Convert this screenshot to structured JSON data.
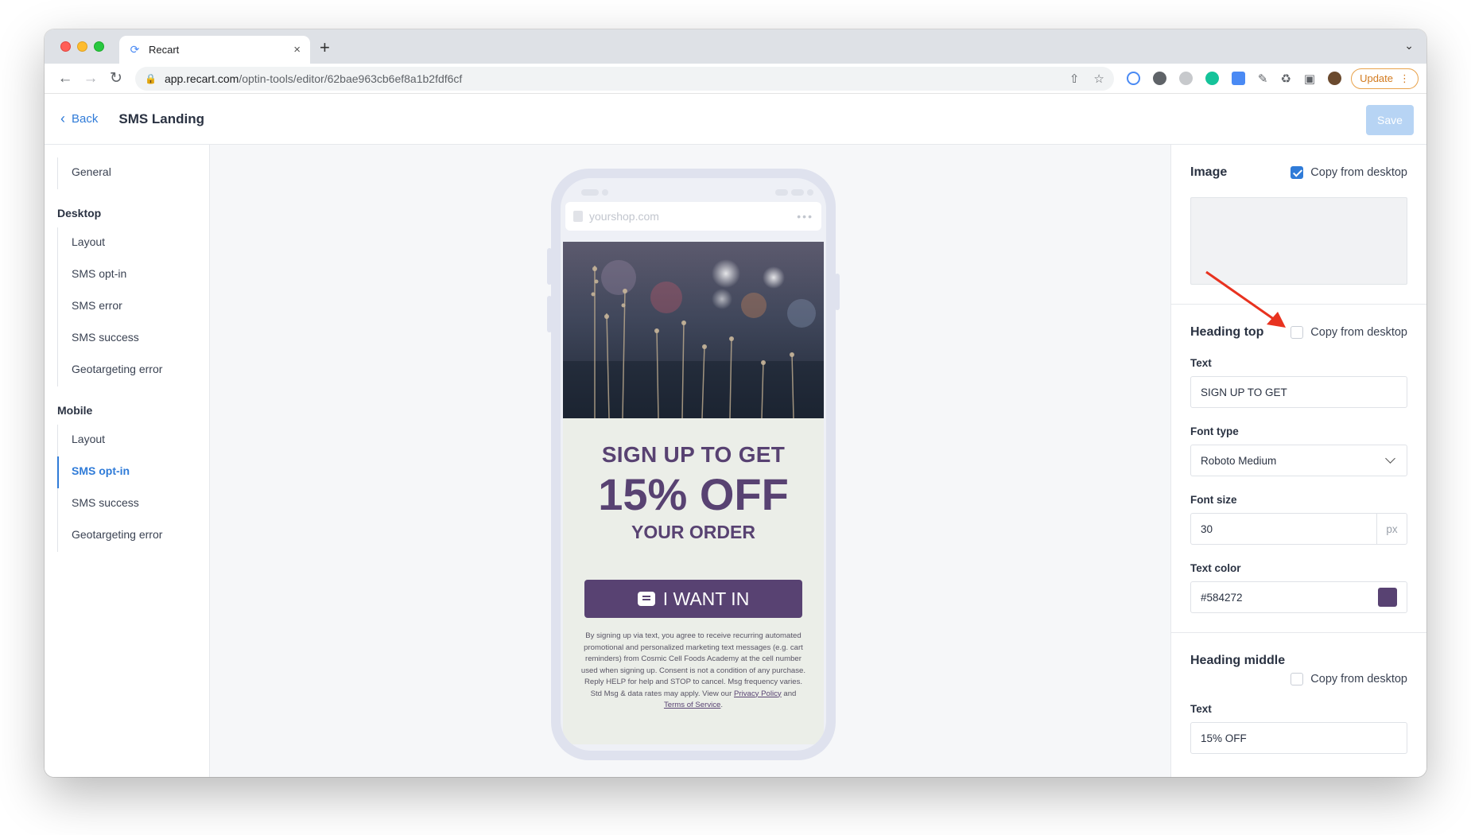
{
  "browser": {
    "tab_title": "Recart",
    "tab_close": "×",
    "new_tab": "+",
    "url_host": "app.recart.com",
    "url_path": "/optin-tools/editor/62bae963cb6ef8a1b2fdf6cf",
    "update_label": "Update",
    "icons": [
      "back-arrow-icon",
      "forward-arrow-icon",
      "reload-icon",
      "lock-icon",
      "share-icon",
      "bookmark-star-icon",
      "extension-icon",
      "puzzle-icon",
      "sidepanel-icon",
      "profile-avatar"
    ]
  },
  "header": {
    "back_label": "Back",
    "page_title": "SMS Landing",
    "save_label": "Save"
  },
  "sidebar": {
    "general": "General",
    "desktop_title": "Desktop",
    "desktop_items": [
      "Layout",
      "SMS opt-in",
      "SMS error",
      "SMS success",
      "Geotargeting error"
    ],
    "mobile_title": "Mobile",
    "mobile_items": [
      "Layout",
      "SMS opt-in",
      "SMS success",
      "Geotargeting error"
    ],
    "active_item": "Mobile / SMS opt-in"
  },
  "preview": {
    "address": "yourshop.com",
    "heading_top": "SIGN UP TO GET",
    "heading_middle": "15% OFF",
    "heading_bottom": "YOUR ORDER",
    "cta_label": "I WANT IN",
    "legal_text": "By signing up via text, you agree to receive recurring automated promotional and personalized marketing text messages (e.g. cart reminders) from Cosmic Cell Foods Academy at the cell number used when signing up. Consent is not a condition of any purchase. Reply HELP for help and STOP to cancel. Msg frequency varies. Std Msg & data rates may apply. View our",
    "privacy_link": "Privacy Policy",
    "and_word": "and",
    "terms_link": "Terms of Service",
    "period": ".",
    "text_color": "#584272",
    "body_background": "#ebeee8"
  },
  "panel": {
    "image": {
      "title": "Image",
      "copy_label": "Copy from desktop",
      "copy_checked": true
    },
    "heading_top": {
      "title": "Heading top",
      "copy_label": "Copy from desktop",
      "copy_checked": false,
      "text_label": "Text",
      "text_value": "SIGN UP TO GET",
      "font_type_label": "Font type",
      "font_type_value": "Roboto Medium",
      "font_size_label": "Font size",
      "font_size_value": "30",
      "font_size_unit": "px",
      "text_color_label": "Text color",
      "text_color_value": "#584272"
    },
    "heading_middle": {
      "title": "Heading middle",
      "copy_label": "Copy from desktop",
      "copy_checked": false,
      "text_label": "Text",
      "text_value": "15% OFF"
    }
  },
  "colors": {
    "accent": "#2f7bd8",
    "brand_purple": "#584272",
    "annotation_arrow": "#e8321f"
  }
}
